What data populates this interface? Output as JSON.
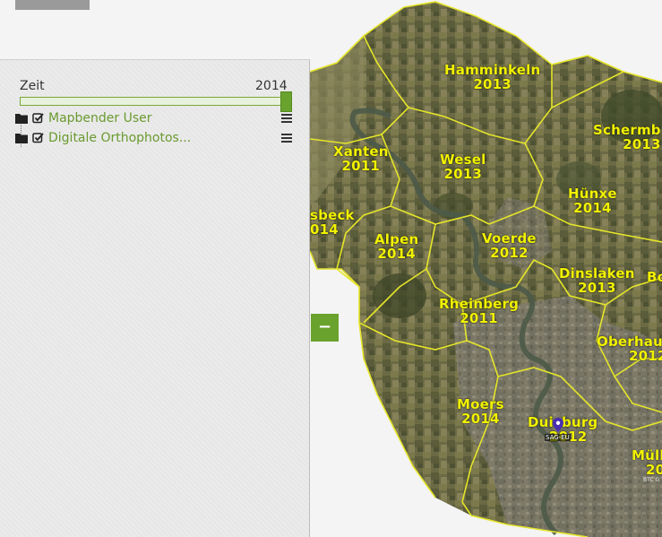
{
  "sidebar": {
    "time_slider": {
      "label": "Zeit",
      "year": "2014",
      "position": 1.0
    },
    "layers": [
      {
        "label": "Mapbender User",
        "checked": true
      },
      {
        "label": "Digitale Orthophotos...",
        "checked": true
      }
    ]
  },
  "map": {
    "districts": [
      {
        "name": "Hamminkeln",
        "year": "2013"
      },
      {
        "name": "Schermb",
        "year": "2013"
      },
      {
        "name": "Xanten",
        "year": "2011"
      },
      {
        "name": "Wesel",
        "year": "2013"
      },
      {
        "name": "Hünxe",
        "year": "2014"
      },
      {
        "name": "sbeck",
        "year": "014"
      },
      {
        "name": "Alpen",
        "year": "2014"
      },
      {
        "name": "Voerde",
        "year": "2012"
      },
      {
        "name": "Dinslaken",
        "year": "2013"
      },
      {
        "name": "Bo",
        "year": ""
      },
      {
        "name": "Rheinberg",
        "year": "2011"
      },
      {
        "name": "Oberhau",
        "year": "2012"
      },
      {
        "name": "Moers",
        "year": "2014"
      },
      {
        "name": "Duisburg",
        "year": "2012"
      },
      {
        "name": "Mülh",
        "year": "20"
      }
    ],
    "pin_label": "SAG-EU",
    "copyright": "BTC G"
  },
  "toggle_button": {
    "label": "−"
  },
  "colors": {
    "accent": "#6aa22e",
    "boundary": "#e5e52a",
    "label": "#f2f200"
  },
  "icons": [
    "folder-icon",
    "checkbox-checked-icon",
    "menu-icon",
    "map-pin-icon"
  ]
}
